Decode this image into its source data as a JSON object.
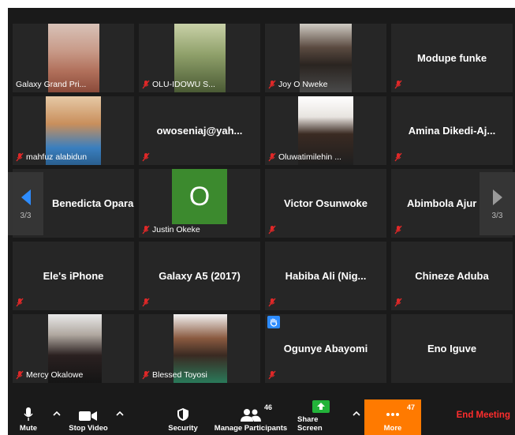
{
  "pagination": {
    "left": "3/3",
    "right": "3/3"
  },
  "participants": [
    {
      "name": "Galaxy Grand Pri..."
    },
    {
      "name": "OLU-IDOWU S..."
    },
    {
      "name": "Joy O Nweke"
    },
    {
      "name": "Modupe funke"
    },
    {
      "name": "mahfuz alabidun"
    },
    {
      "name": "owoseniaj@yah..."
    },
    {
      "name": "Oluwatimilehin ..."
    },
    {
      "name": "Amina  Dikedi-Aj..."
    },
    {
      "name": "Benedicta Opara"
    },
    {
      "name": "Justin Okeke",
      "initial": "O"
    },
    {
      "name": "Victor Osunwoke"
    },
    {
      "name": "Abimbola  Ajur"
    },
    {
      "name": "Ele's iPhone"
    },
    {
      "name": "Galaxy A5 (2017)"
    },
    {
      "name": "Habiba Ali  (Nig..."
    },
    {
      "name": "Chineze Aduba"
    },
    {
      "name": "Mercy Okalowe"
    },
    {
      "name": "Blessed Toyosi"
    },
    {
      "name": "Ogunye Abayomi"
    },
    {
      "name": "Eno Iguve"
    }
  ],
  "toolbar": {
    "mute": "Mute",
    "stop_video": "Stop Video",
    "security": "Security",
    "manage_participants": "Manage Participants",
    "participants_count": "46",
    "share_screen": "Share Screen",
    "more": "More",
    "more_count": "47",
    "end_meeting": "End Meeting"
  },
  "colors": {
    "accent": "#2d8cff",
    "share_green": "#23b33a",
    "more_orange": "#ff7a00",
    "end_red": "#ff2d2d",
    "tile_bg": "#262626"
  }
}
